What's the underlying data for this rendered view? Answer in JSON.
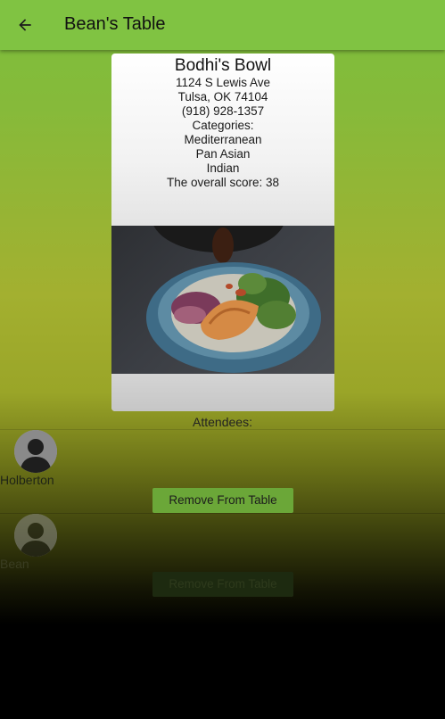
{
  "app_bar": {
    "title": "Bean's Table",
    "back_icon": "arrow-left-icon"
  },
  "restaurant": {
    "name": "Bodhi's Bowl",
    "street": "1124 S Lewis Ave",
    "city_line": "Tulsa, OK 74104",
    "phone": "(918) 928-1357",
    "categories_label": "Categories:",
    "categories": [
      "Mediterranean",
      "Pan Asian",
      "Indian"
    ],
    "score_line": "The overall score: 38"
  },
  "attendees": {
    "label": "Attendees:",
    "items": [
      {
        "name": "Holberton",
        "remove_label": "Remove From Table"
      },
      {
        "name": "Bean",
        "remove_label": "Remove From Table"
      }
    ]
  },
  "colors": {
    "app_bar": "#80c342",
    "button": "#6ba738"
  }
}
